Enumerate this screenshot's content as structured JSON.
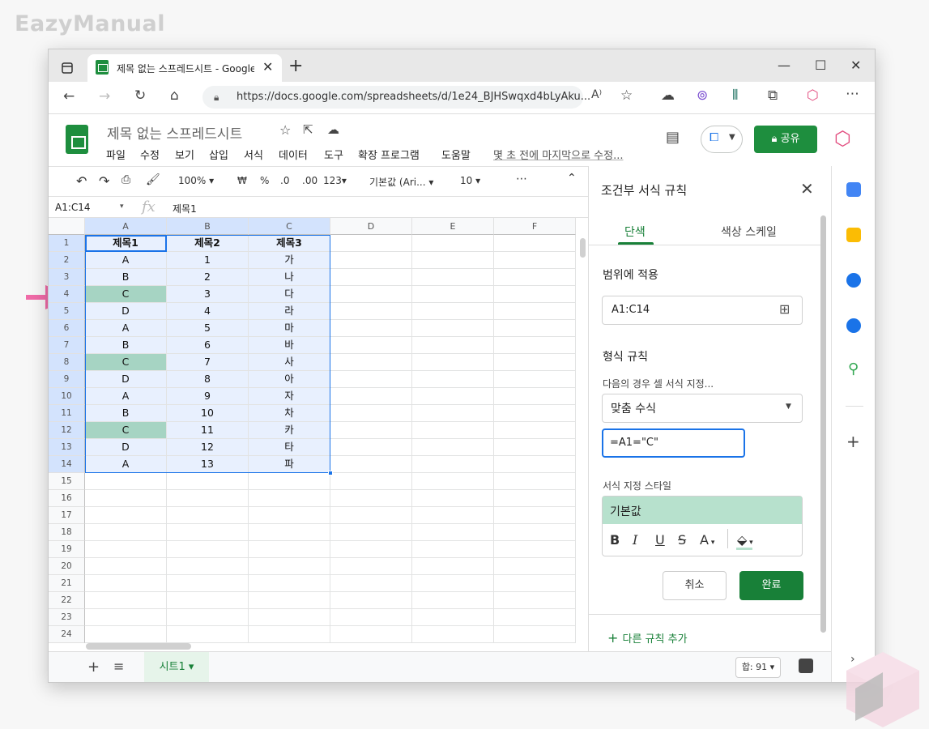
{
  "watermark": "EazyManual",
  "browser": {
    "tab_title": "제목 없는 스프레드시트 - Google",
    "url": "https://docs.google.com/spreadsheets/d/1e24_BJHSwqxd4bLyAku..."
  },
  "sheets_app": {
    "doc_title": "제목 없는 스프레드시트",
    "menu": [
      "파일",
      "수정",
      "보기",
      "삽입",
      "서식",
      "데이터",
      "도구",
      "확장 프로그램",
      "도움말"
    ],
    "last_edit": "몇 초 전에 마지막으로 수정...",
    "share_label": "공유"
  },
  "toolbar": {
    "zoom": "100%",
    "currency": "₩",
    "percent": "%",
    "dec_decrease": ".0",
    "dec_increase": ".00",
    "format_more": "123",
    "font": "기본값 (Ari...",
    "font_size": "10",
    "more": "⋯"
  },
  "formula_bar": {
    "name_box": "A1:C14",
    "fx": "fx",
    "value": "제목1"
  },
  "grid": {
    "columns": [
      "A",
      "B",
      "C",
      "D",
      "E",
      "F"
    ],
    "rows": [
      "1",
      "2",
      "3",
      "4",
      "5",
      "6",
      "7",
      "8",
      "9",
      "10",
      "11",
      "12",
      "13",
      "14",
      "15",
      "16",
      "17",
      "18",
      "19",
      "20",
      "21",
      "22",
      "23",
      "24"
    ],
    "data": [
      [
        "제목1",
        "제목2",
        "제목3"
      ],
      [
        "A",
        "1",
        "가"
      ],
      [
        "B",
        "2",
        "나"
      ],
      [
        "C",
        "3",
        "다"
      ],
      [
        "D",
        "4",
        "라"
      ],
      [
        "A",
        "5",
        "마"
      ],
      [
        "B",
        "6",
        "바"
      ],
      [
        "C",
        "7",
        "사"
      ],
      [
        "D",
        "8",
        "아"
      ],
      [
        "A",
        "9",
        "자"
      ],
      [
        "B",
        "10",
        "차"
      ],
      [
        "C",
        "11",
        "카"
      ],
      [
        "D",
        "12",
        "타"
      ],
      [
        "A",
        "13",
        "파"
      ]
    ],
    "highlight_fill": "#a6d4c3",
    "selection_fill": "#e8f0fe"
  },
  "sheet_bar": {
    "sheet_name": "시트1",
    "sum": "합: 91"
  },
  "cf_panel": {
    "title": "조건부 서식 규칙",
    "tab_single": "단색",
    "tab_scale": "색상 스케일",
    "apply_range_label": "범위에 적용",
    "range_value": "A1:C14",
    "format_rules_label": "형식 규칙",
    "condition_label": "다음의 경우 셀 서식 지정...",
    "condition_value": "맞춤 수식",
    "formula_value": "=A1=\"C\"",
    "style_label": "서식 지정 스타일",
    "style_preview": "기본값",
    "style_tools": [
      "B",
      "I",
      "U",
      "S",
      "A"
    ],
    "cancel_label": "취소",
    "done_label": "완료",
    "add_rule_label": "다른 규칙 추가"
  },
  "colors": {
    "sheets_green": "#188038",
    "selection_blue": "#1a73e8",
    "arrow_pink": "#f06ba8"
  }
}
